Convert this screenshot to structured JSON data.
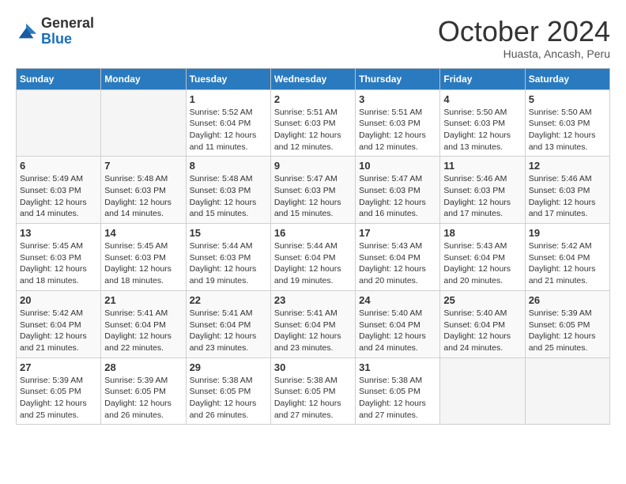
{
  "logo": {
    "general": "General",
    "blue": "Blue"
  },
  "title": "October 2024",
  "subtitle": "Huasta, Ancash, Peru",
  "days_of_week": [
    "Sunday",
    "Monday",
    "Tuesday",
    "Wednesday",
    "Thursday",
    "Friday",
    "Saturday"
  ],
  "weeks": [
    [
      {
        "day": "",
        "sunrise": "",
        "sunset": "",
        "daylight": ""
      },
      {
        "day": "",
        "sunrise": "",
        "sunset": "",
        "daylight": ""
      },
      {
        "day": "1",
        "sunrise": "Sunrise: 5:52 AM",
        "sunset": "Sunset: 6:04 PM",
        "daylight": "Daylight: 12 hours and 11 minutes."
      },
      {
        "day": "2",
        "sunrise": "Sunrise: 5:51 AM",
        "sunset": "Sunset: 6:03 PM",
        "daylight": "Daylight: 12 hours and 12 minutes."
      },
      {
        "day": "3",
        "sunrise": "Sunrise: 5:51 AM",
        "sunset": "Sunset: 6:03 PM",
        "daylight": "Daylight: 12 hours and 12 minutes."
      },
      {
        "day": "4",
        "sunrise": "Sunrise: 5:50 AM",
        "sunset": "Sunset: 6:03 PM",
        "daylight": "Daylight: 12 hours and 13 minutes."
      },
      {
        "day": "5",
        "sunrise": "Sunrise: 5:50 AM",
        "sunset": "Sunset: 6:03 PM",
        "daylight": "Daylight: 12 hours and 13 minutes."
      }
    ],
    [
      {
        "day": "6",
        "sunrise": "Sunrise: 5:49 AM",
        "sunset": "Sunset: 6:03 PM",
        "daylight": "Daylight: 12 hours and 14 minutes."
      },
      {
        "day": "7",
        "sunrise": "Sunrise: 5:48 AM",
        "sunset": "Sunset: 6:03 PM",
        "daylight": "Daylight: 12 hours and 14 minutes."
      },
      {
        "day": "8",
        "sunrise": "Sunrise: 5:48 AM",
        "sunset": "Sunset: 6:03 PM",
        "daylight": "Daylight: 12 hours and 15 minutes."
      },
      {
        "day": "9",
        "sunrise": "Sunrise: 5:47 AM",
        "sunset": "Sunset: 6:03 PM",
        "daylight": "Daylight: 12 hours and 15 minutes."
      },
      {
        "day": "10",
        "sunrise": "Sunrise: 5:47 AM",
        "sunset": "Sunset: 6:03 PM",
        "daylight": "Daylight: 12 hours and 16 minutes."
      },
      {
        "day": "11",
        "sunrise": "Sunrise: 5:46 AM",
        "sunset": "Sunset: 6:03 PM",
        "daylight": "Daylight: 12 hours and 17 minutes."
      },
      {
        "day": "12",
        "sunrise": "Sunrise: 5:46 AM",
        "sunset": "Sunset: 6:03 PM",
        "daylight": "Daylight: 12 hours and 17 minutes."
      }
    ],
    [
      {
        "day": "13",
        "sunrise": "Sunrise: 5:45 AM",
        "sunset": "Sunset: 6:03 PM",
        "daylight": "Daylight: 12 hours and 18 minutes."
      },
      {
        "day": "14",
        "sunrise": "Sunrise: 5:45 AM",
        "sunset": "Sunset: 6:03 PM",
        "daylight": "Daylight: 12 hours and 18 minutes."
      },
      {
        "day": "15",
        "sunrise": "Sunrise: 5:44 AM",
        "sunset": "Sunset: 6:03 PM",
        "daylight": "Daylight: 12 hours and 19 minutes."
      },
      {
        "day": "16",
        "sunrise": "Sunrise: 5:44 AM",
        "sunset": "Sunset: 6:04 PM",
        "daylight": "Daylight: 12 hours and 19 minutes."
      },
      {
        "day": "17",
        "sunrise": "Sunrise: 5:43 AM",
        "sunset": "Sunset: 6:04 PM",
        "daylight": "Daylight: 12 hours and 20 minutes."
      },
      {
        "day": "18",
        "sunrise": "Sunrise: 5:43 AM",
        "sunset": "Sunset: 6:04 PM",
        "daylight": "Daylight: 12 hours and 20 minutes."
      },
      {
        "day": "19",
        "sunrise": "Sunrise: 5:42 AM",
        "sunset": "Sunset: 6:04 PM",
        "daylight": "Daylight: 12 hours and 21 minutes."
      }
    ],
    [
      {
        "day": "20",
        "sunrise": "Sunrise: 5:42 AM",
        "sunset": "Sunset: 6:04 PM",
        "daylight": "Daylight: 12 hours and 21 minutes."
      },
      {
        "day": "21",
        "sunrise": "Sunrise: 5:41 AM",
        "sunset": "Sunset: 6:04 PM",
        "daylight": "Daylight: 12 hours and 22 minutes."
      },
      {
        "day": "22",
        "sunrise": "Sunrise: 5:41 AM",
        "sunset": "Sunset: 6:04 PM",
        "daylight": "Daylight: 12 hours and 23 minutes."
      },
      {
        "day": "23",
        "sunrise": "Sunrise: 5:41 AM",
        "sunset": "Sunset: 6:04 PM",
        "daylight": "Daylight: 12 hours and 23 minutes."
      },
      {
        "day": "24",
        "sunrise": "Sunrise: 5:40 AM",
        "sunset": "Sunset: 6:04 PM",
        "daylight": "Daylight: 12 hours and 24 minutes."
      },
      {
        "day": "25",
        "sunrise": "Sunrise: 5:40 AM",
        "sunset": "Sunset: 6:04 PM",
        "daylight": "Daylight: 12 hours and 24 minutes."
      },
      {
        "day": "26",
        "sunrise": "Sunrise: 5:39 AM",
        "sunset": "Sunset: 6:05 PM",
        "daylight": "Daylight: 12 hours and 25 minutes."
      }
    ],
    [
      {
        "day": "27",
        "sunrise": "Sunrise: 5:39 AM",
        "sunset": "Sunset: 6:05 PM",
        "daylight": "Daylight: 12 hours and 25 minutes."
      },
      {
        "day": "28",
        "sunrise": "Sunrise: 5:39 AM",
        "sunset": "Sunset: 6:05 PM",
        "daylight": "Daylight: 12 hours and 26 minutes."
      },
      {
        "day": "29",
        "sunrise": "Sunrise: 5:38 AM",
        "sunset": "Sunset: 6:05 PM",
        "daylight": "Daylight: 12 hours and 26 minutes."
      },
      {
        "day": "30",
        "sunrise": "Sunrise: 5:38 AM",
        "sunset": "Sunset: 6:05 PM",
        "daylight": "Daylight: 12 hours and 27 minutes."
      },
      {
        "day": "31",
        "sunrise": "Sunrise: 5:38 AM",
        "sunset": "Sunset: 6:05 PM",
        "daylight": "Daylight: 12 hours and 27 minutes."
      },
      {
        "day": "",
        "sunrise": "",
        "sunset": "",
        "daylight": ""
      },
      {
        "day": "",
        "sunrise": "",
        "sunset": "",
        "daylight": ""
      }
    ]
  ]
}
